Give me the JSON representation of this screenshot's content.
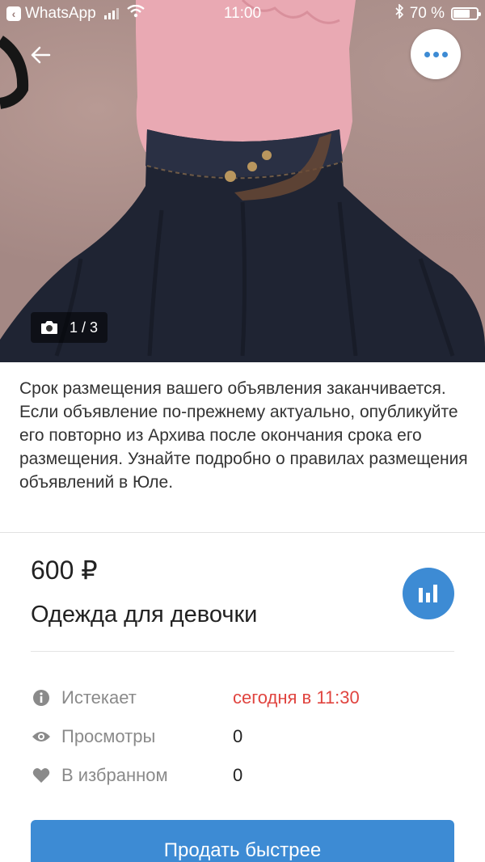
{
  "status_bar": {
    "app": "WhatsApp",
    "time": "11:00",
    "battery": "70 %",
    "battery_level": 0.7
  },
  "photo": {
    "counter": "1 / 3"
  },
  "notice": "Срок размещения вашего объявления заканчивается. Если объявление по-прежнему актуально, опубликуйте его повторно из Архива после окончания срока его размещения. Узнайте подробно о правилах размещения объявлений в Юле.",
  "listing": {
    "price": "600 ₽",
    "title": "Одежда для девочки"
  },
  "info": [
    {
      "icon": "info-icon",
      "label": "Истекает",
      "value": "сегодня в 11:30"
    },
    {
      "icon": "eye-icon",
      "label": "Просмотры",
      "value": "0"
    },
    {
      "icon": "heart-icon",
      "label": "В избранном",
      "value": "0"
    }
  ],
  "actions": {
    "sell_faster": "Продать быстрее"
  },
  "colors": {
    "accent": "#3d8bd4",
    "warning": "#e0443f"
  }
}
